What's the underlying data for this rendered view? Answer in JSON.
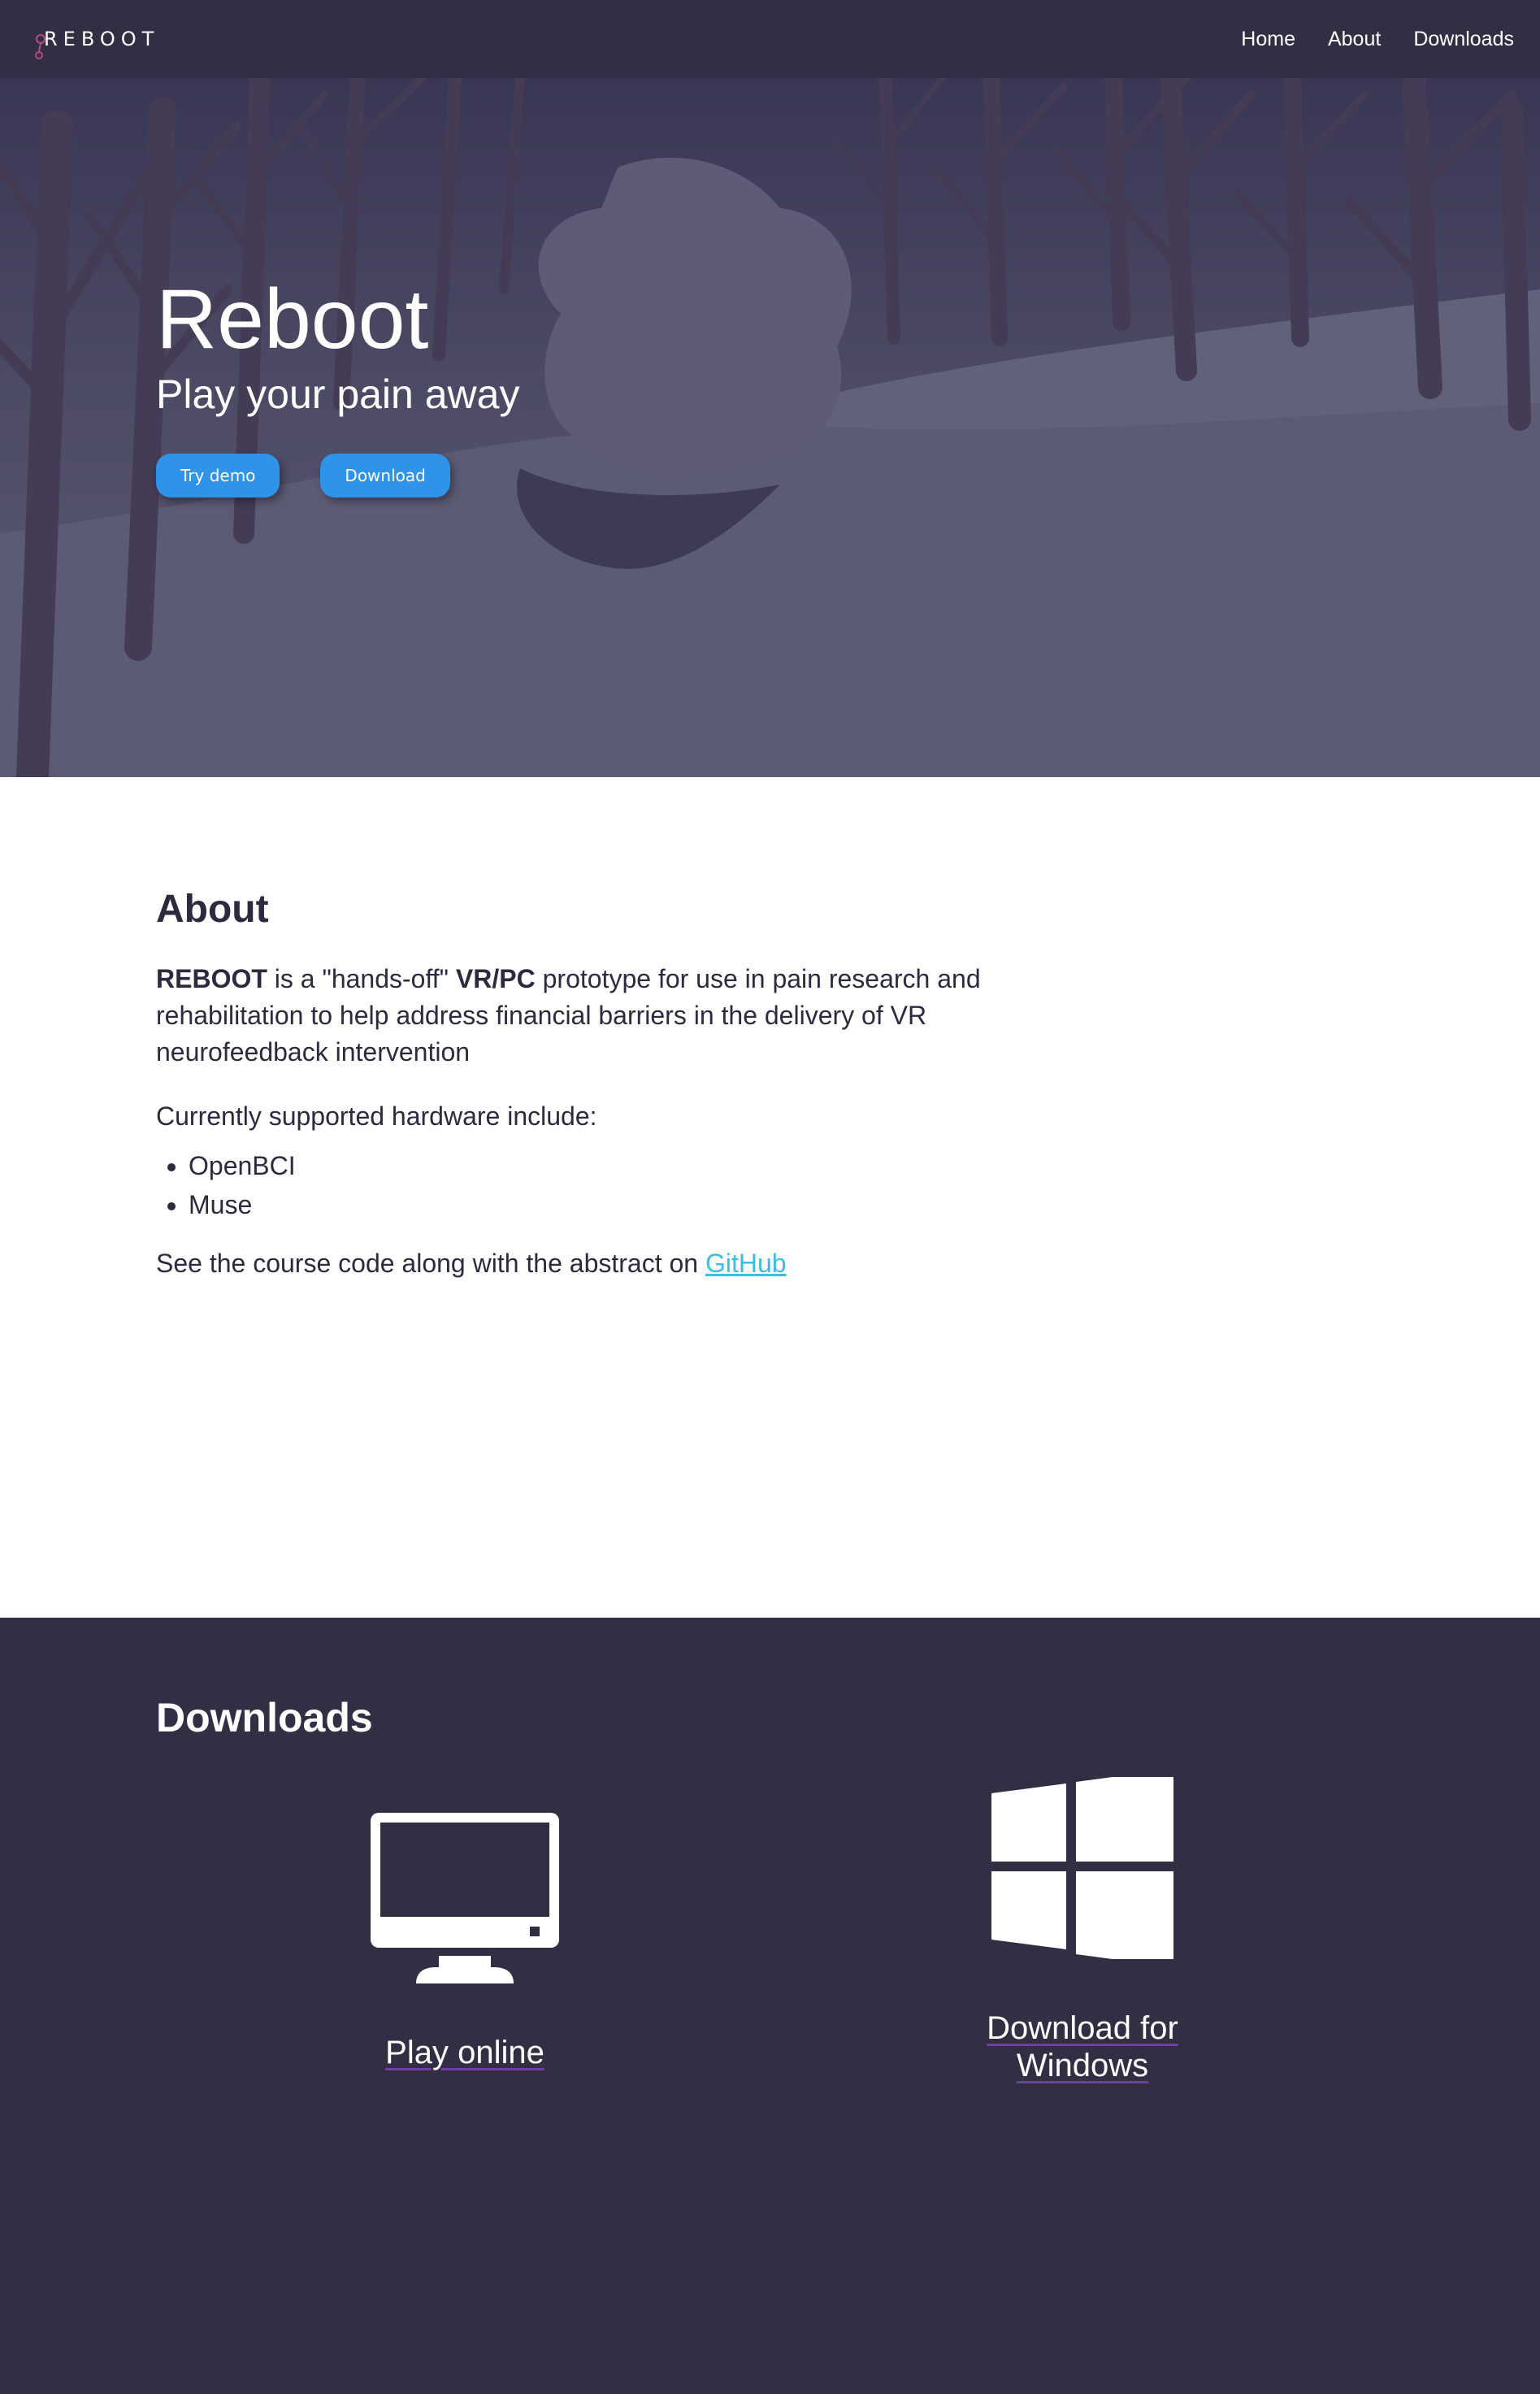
{
  "navbar": {
    "brand": "REBOOT",
    "links": [
      "Home",
      "About",
      "Downloads"
    ]
  },
  "hero": {
    "title": "Reboot",
    "subtitle": "Play your pain away",
    "buttons": [
      "Try demo",
      "Download"
    ]
  },
  "about": {
    "heading": "About",
    "intro": {
      "brand": "REBOOT",
      "part1": " is a \"hands-off\" ",
      "platform": "VR/PC",
      "part2": " prototype for use in pain research and rehabilitation to help address financial barriers in the delivery of VR neurofeedback intervention"
    },
    "hardware_intro": "Currently supported hardware include:",
    "hardware": [
      "OpenBCI",
      "Muse"
    ],
    "source_text": "See the course code along with the abstract on ",
    "source_link": "GitHub"
  },
  "downloads": {
    "heading": "Downloads",
    "items": [
      {
        "icon": "monitor-icon",
        "label": "Play online"
      },
      {
        "icon": "windows-icon",
        "label": "Download for Windows"
      }
    ]
  },
  "colors": {
    "navbar": "#322f45",
    "button": "#2f93ea",
    "link": "#3bbde2",
    "text": "#2c2a3e"
  }
}
